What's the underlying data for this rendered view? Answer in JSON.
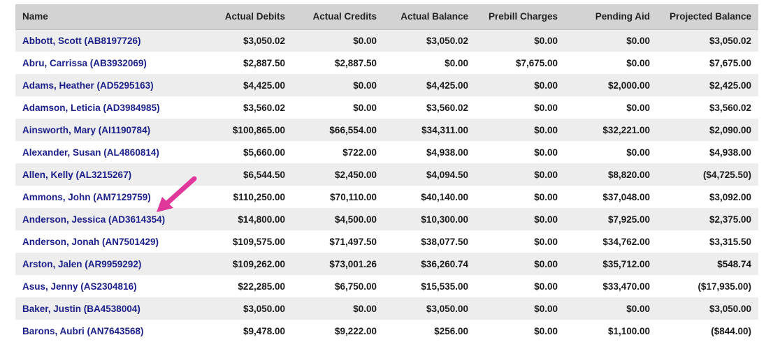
{
  "table": {
    "columns": [
      "Name",
      "Actual Debits",
      "Actual Credits",
      "Actual Balance",
      "Prebill Charges",
      "Pending Aid",
      "Projected Balance"
    ],
    "rows": [
      {
        "name": "Abbott, Scott (AB8197726)",
        "actual_debits": "$3,050.02",
        "actual_credits": "$0.00",
        "actual_balance": "$3,050.02",
        "prebill_charges": "$0.00",
        "pending_aid": "$0.00",
        "projected_balance": "$3,050.02"
      },
      {
        "name": "Abru, Carrissa (AB3932069)",
        "actual_debits": "$2,887.50",
        "actual_credits": "$2,887.50",
        "actual_balance": "$0.00",
        "prebill_charges": "$7,675.00",
        "pending_aid": "$0.00",
        "projected_balance": "$7,675.00"
      },
      {
        "name": "Adams, Heather (AD5295163)",
        "actual_debits": "$4,425.00",
        "actual_credits": "$0.00",
        "actual_balance": "$4,425.00",
        "prebill_charges": "$0.00",
        "pending_aid": "$2,000.00",
        "projected_balance": "$2,425.00"
      },
      {
        "name": "Adamson, Leticia (AD3984985)",
        "actual_debits": "$3,560.02",
        "actual_credits": "$0.00",
        "actual_balance": "$3,560.02",
        "prebill_charges": "$0.00",
        "pending_aid": "$0.00",
        "projected_balance": "$3,560.02"
      },
      {
        "name": "Ainsworth, Mary (AI1190784)",
        "actual_debits": "$100,865.00",
        "actual_credits": "$66,554.00",
        "actual_balance": "$34,311.00",
        "prebill_charges": "$0.00",
        "pending_aid": "$32,221.00",
        "projected_balance": "$2,090.00"
      },
      {
        "name": "Alexander, Susan (AL4860814)",
        "actual_debits": "$5,660.00",
        "actual_credits": "$722.00",
        "actual_balance": "$4,938.00",
        "prebill_charges": "$0.00",
        "pending_aid": "$0.00",
        "projected_balance": "$4,938.00"
      },
      {
        "name": "Allen, Kelly (AL3215267)",
        "actual_debits": "$6,544.50",
        "actual_credits": "$2,450.00",
        "actual_balance": "$4,094.50",
        "prebill_charges": "$0.00",
        "pending_aid": "$8,820.00",
        "projected_balance": "($4,725.50)"
      },
      {
        "name": "Ammons, John (AM7129759)",
        "actual_debits": "$110,250.00",
        "actual_credits": "$70,110.00",
        "actual_balance": "$40,140.00",
        "prebill_charges": "$0.00",
        "pending_aid": "$37,048.00",
        "projected_balance": "$3,092.00"
      },
      {
        "name": "Anderson, Jessica (AD3614354)",
        "actual_debits": "$14,800.00",
        "actual_credits": "$4,500.00",
        "actual_balance": "$10,300.00",
        "prebill_charges": "$0.00",
        "pending_aid": "$7,925.00",
        "projected_balance": "$2,375.00"
      },
      {
        "name": "Anderson, Jonah (AN7501429)",
        "actual_debits": "$109,575.00",
        "actual_credits": "$71,497.50",
        "actual_balance": "$38,077.50",
        "prebill_charges": "$0.00",
        "pending_aid": "$34,762.00",
        "projected_balance": "$3,315.50"
      },
      {
        "name": "Arston, Jalen (AR9959292)",
        "actual_debits": "$109,262.00",
        "actual_credits": "$73,001.26",
        "actual_balance": "$36,260.74",
        "prebill_charges": "$0.00",
        "pending_aid": "$35,712.00",
        "projected_balance": "$548.74"
      },
      {
        "name": "Asus, Jenny (AS2304816)",
        "actual_debits": "$22,285.00",
        "actual_credits": "$6,750.00",
        "actual_balance": "$15,535.00",
        "prebill_charges": "$0.00",
        "pending_aid": "$33,470.00",
        "projected_balance": "($17,935.00)"
      },
      {
        "name": "Baker, Justin (BA4538004)",
        "actual_debits": "$3,050.00",
        "actual_credits": "$0.00",
        "actual_balance": "$3,050.00",
        "prebill_charges": "$0.00",
        "pending_aid": "$0.00",
        "projected_balance": "$3,050.00"
      },
      {
        "name": "Barons, Aubri (AN7643568)",
        "actual_debits": "$9,478.00",
        "actual_credits": "$9,222.00",
        "actual_balance": "$256.00",
        "prebill_charges": "$0.00",
        "pending_aid": "$1,100.00",
        "projected_balance": "($844.00)"
      }
    ]
  },
  "colors": {
    "header_bg": "#d3d3d3",
    "row_alt_bg": "#ededed",
    "link": "#1b1f8a",
    "arrow": "#e0389a"
  },
  "icons": {
    "annotation": "arrow-pointer-icon"
  }
}
